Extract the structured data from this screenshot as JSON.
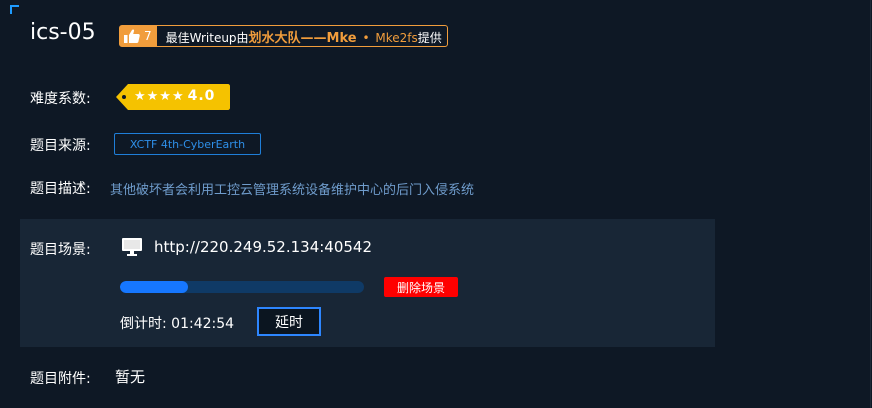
{
  "challenge": {
    "title": "ics-05"
  },
  "writeup": {
    "likes": "7",
    "prefix": "最佳Writeup由",
    "team": "划水大队——Mke",
    "dot": "•",
    "person": "Mke2fs",
    "suffix": "提供"
  },
  "difficulty": {
    "label": "难度系数:",
    "stars": "★★★★",
    "score": "4.0",
    "color": "#f5c200"
  },
  "source": {
    "label": "题目来源:",
    "tag": "XCTF 4th-CyberEarth"
  },
  "description": {
    "label": "题目描述:",
    "text": "其他破坏者会利用工控云管理系统设备维护中心的后门入侵系统"
  },
  "scene": {
    "label": "题目场景:",
    "url": "http://220.249.52.134:40542",
    "progress_percent": 28,
    "delete_label": "删除场景",
    "countdown_label": "倒计时:",
    "countdown_value": "01:42:54",
    "delay_label": "延时"
  },
  "attachment": {
    "label": "题目附件:",
    "value": "暂无"
  }
}
